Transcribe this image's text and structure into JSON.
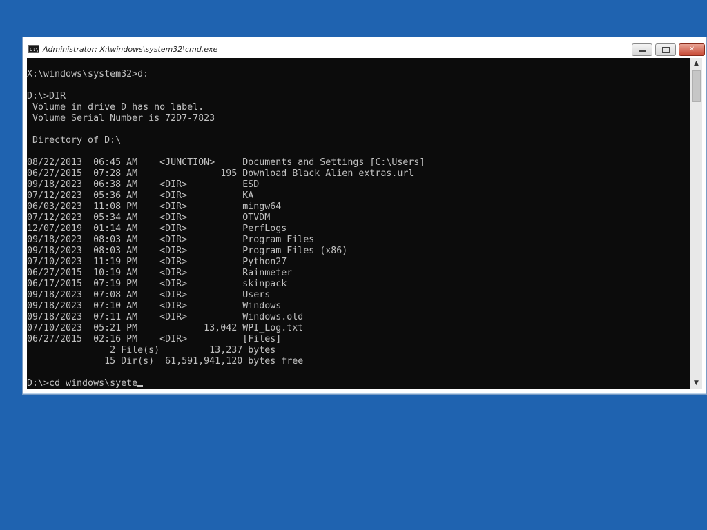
{
  "window": {
    "title": "Administrator: X:\\windows\\system32\\cmd.exe",
    "icon": "cmd-icon",
    "controls": {
      "minimize": "minimize-icon",
      "maximize": "restore-icon",
      "close": "close-icon"
    }
  },
  "console": {
    "lines": [
      "",
      "X:\\windows\\system32>d:",
      "",
      "D:\\>DIR",
      " Volume in drive D has no label.",
      " Volume Serial Number is 72D7-7823",
      "",
      " Directory of D:\\",
      "",
      "08/22/2013  06:45 AM    <JUNCTION>     Documents and Settings [C:\\Users]",
      "06/27/2015  07:28 AM               195 Download Black Alien extras.url",
      "09/18/2023  06:38 AM    <DIR>          ESD",
      "07/12/2023  05:36 AM    <DIR>          KA",
      "06/03/2023  11:08 PM    <DIR>          mingw64",
      "07/12/2023  05:34 AM    <DIR>          OTVDM",
      "12/07/2019  01:14 AM    <DIR>          PerfLogs",
      "09/18/2023  08:03 AM    <DIR>          Program Files",
      "09/18/2023  08:03 AM    <DIR>          Program Files (x86)",
      "07/10/2023  11:19 PM    <DIR>          Python27",
      "06/27/2015  10:19 AM    <DIR>          Rainmeter",
      "06/17/2015  07:19 PM    <DIR>          skinpack",
      "09/18/2023  07:08 AM    <DIR>          Users",
      "09/18/2023  07:10 AM    <DIR>          Windows",
      "09/18/2023  07:11 AM    <DIR>          Windows.old",
      "07/10/2023  05:21 PM            13,042 WPI_Log.txt",
      "06/27/2015  02:16 PM    <DIR>          [Files]",
      "               2 File(s)         13,237 bytes",
      "              15 Dir(s)  61,591,941,120 bytes free",
      ""
    ],
    "prompt": "D:\\>cd windows\\syete"
  },
  "colors": {
    "desktop": "#1f63b0",
    "console_bg": "#0c0c0c",
    "console_fg": "#c0c0c0"
  }
}
